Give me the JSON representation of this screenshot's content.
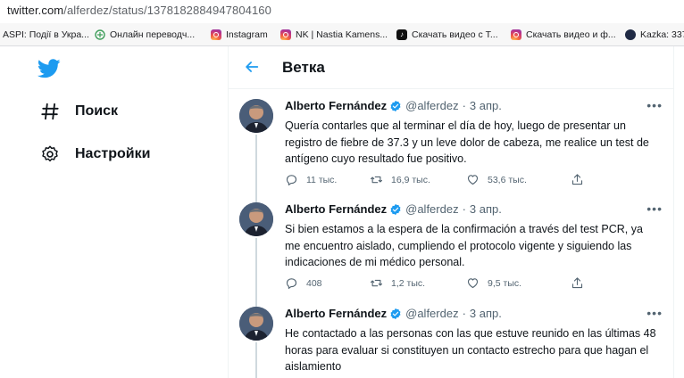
{
  "browser": {
    "url_host": "twitter.com",
    "url_path": "/alferdez/status/1378182884947804160"
  },
  "bookmarks": [
    {
      "label": "ASPI: Події в Укра..."
    },
    {
      "label": "Онлайн переводч..."
    },
    {
      "label": "Instagram"
    },
    {
      "label": "NK | Nastia Kamens..."
    },
    {
      "label": "Скачать видео с Т..."
    },
    {
      "label": "Скачать видео и ф..."
    },
    {
      "label": "Kazka: 337"
    }
  ],
  "sidebar": {
    "items": [
      {
        "label": "Поиск"
      },
      {
        "label": "Настройки"
      }
    ]
  },
  "header": {
    "title": "Ветка"
  },
  "tweets": [
    {
      "name": "Alberto Fernández",
      "handle": "@alferdez",
      "sep": "·",
      "date": "3 апр.",
      "text": "Quería contarles que al terminar el día de hoy, luego de presentar un registro de fiebre de 37.3 y un leve dolor de cabeza, me realice un test de antígeno cuyo resultado fue positivo.",
      "replies": "11 тыс.",
      "retweets": "16,9 тыс.",
      "likes": "53,6 тыс."
    },
    {
      "name": "Alberto Fernández",
      "handle": "@alferdez",
      "sep": "·",
      "date": "3 апр.",
      "text": "Si bien estamos a la espera de la confirmación a través del test PCR, ya me encuentro aislado, cumpliendo el protocolo vigente y siguiendo las indicaciones de mi médico personal.",
      "replies": "408",
      "retweets": "1,2 тыс.",
      "likes": "9,5 тыс."
    },
    {
      "name": "Alberto Fernández",
      "handle": "@alferdez",
      "sep": "·",
      "date": "3 апр.",
      "text": "He contactado a las personas con las que estuve reunido en las últimas 48 horas para evaluar si constituyen un contacto estrecho para que hagan el aislamiento",
      "replies": "",
      "retweets": "",
      "likes": ""
    }
  ],
  "colors": {
    "accent": "#1d9bf0",
    "text": "#0f1419",
    "secondary": "#536471",
    "border": "#eff3f4"
  },
  "icons": {
    "logo": "twitter-bird-icon",
    "search": "hash-icon",
    "settings": "gear-icon",
    "back": "arrow-left-icon",
    "verified": "verified-badge-icon",
    "more": "more-dots-icon",
    "reply": "reply-icon",
    "retweet": "retweet-icon",
    "like": "heart-icon",
    "share": "share-icon"
  }
}
